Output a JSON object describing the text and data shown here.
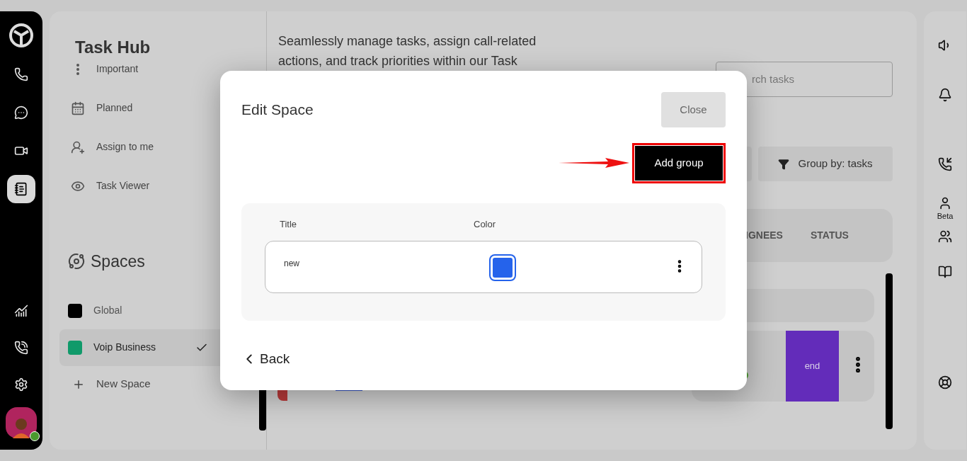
{
  "rail": {
    "items": [
      {
        "selected": false
      },
      {
        "selected": false
      },
      {
        "selected": false
      },
      {
        "selected": true
      }
    ],
    "avatar": {
      "online": true
    }
  },
  "sidebar": {
    "title": "Task Hub",
    "items": [
      {
        "label": "Important"
      },
      {
        "label": "Planned"
      },
      {
        "label": "Assign to me"
      },
      {
        "label": "Task Viewer"
      }
    ],
    "spaces_title": "Spaces",
    "spaces": [
      {
        "label": "Global",
        "color": "#000000",
        "selected": false
      },
      {
        "label": "Voip Business",
        "color": "#109a6a",
        "selected": true
      }
    ],
    "new_space": "New Space"
  },
  "content": {
    "description": [
      "Seamlessly manage tasks, assign call-related",
      "actions, and track priorities within our Task"
    ],
    "search": {
      "placeholder": "rch tasks"
    },
    "group_by": "Group by: tasks",
    "columns": [
      "IGNEES",
      "STATUS"
    ],
    "row": {
      "status": "end"
    }
  },
  "modal": {
    "title": "Edit Space",
    "close": "Close",
    "add_group": "Add group",
    "highlighted": true,
    "columns": [
      "Title",
      "Color"
    ],
    "groups": [
      {
        "title": "new",
        "color": "#2563eb"
      }
    ],
    "back": "Back"
  },
  "right_rail": {
    "beta_label": "Beta"
  }
}
